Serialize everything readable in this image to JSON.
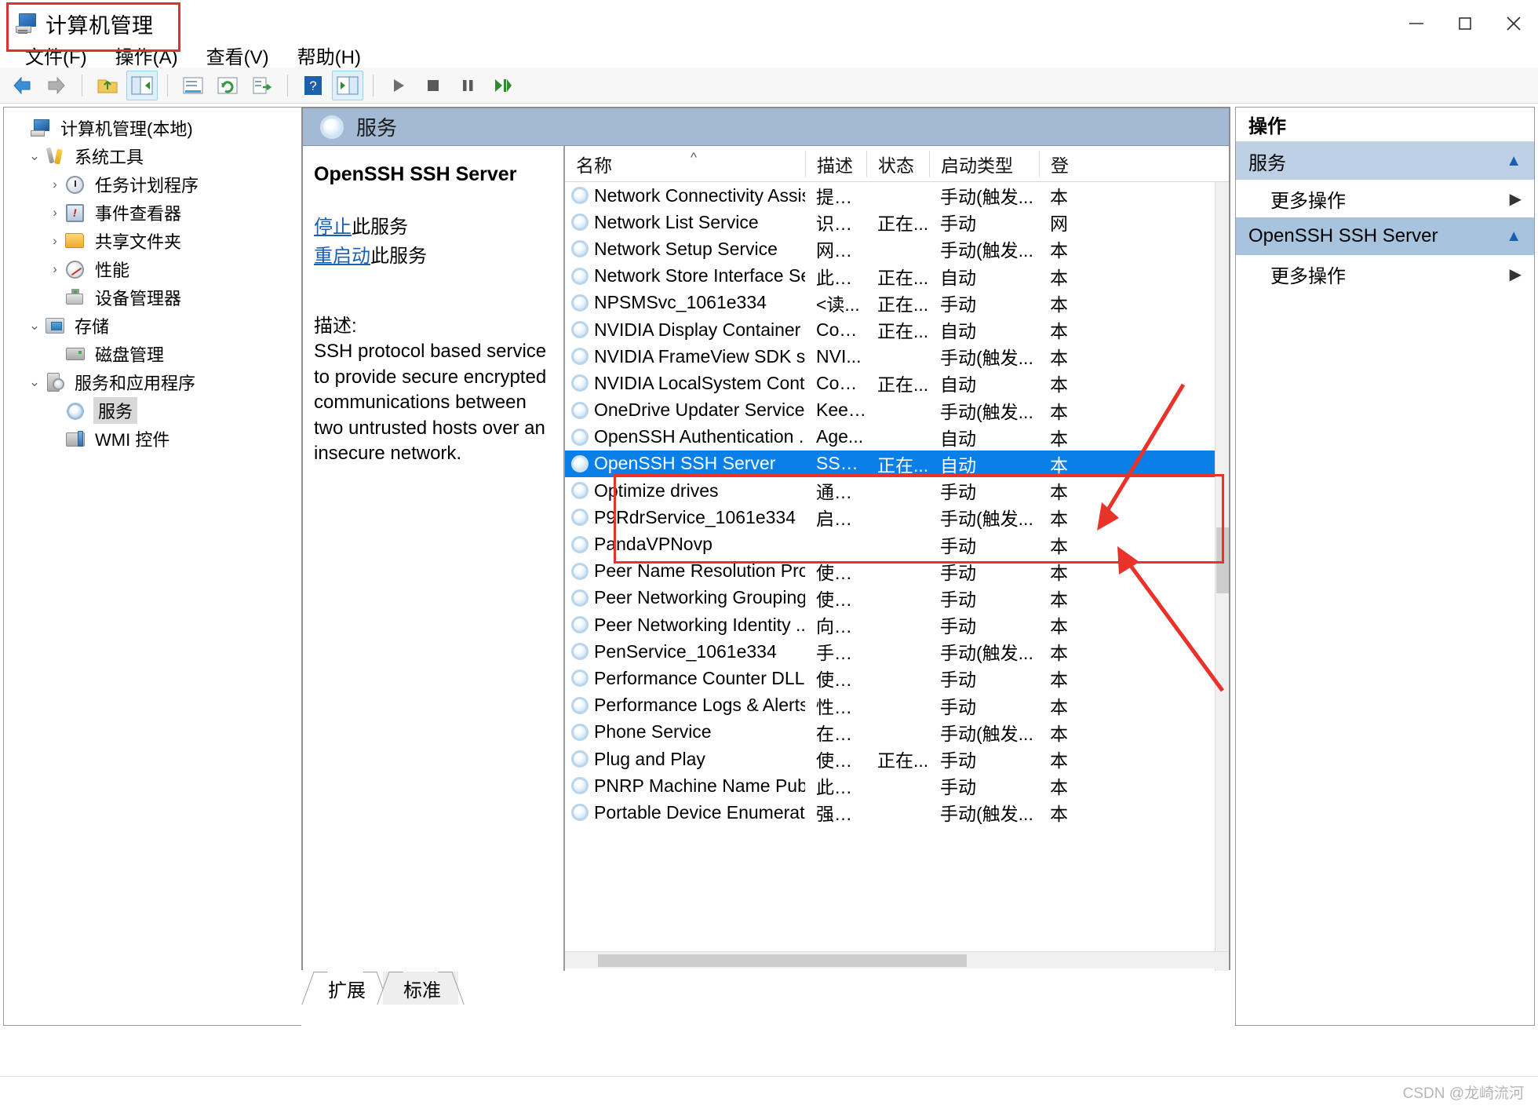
{
  "window": {
    "title": "计算机管理",
    "icon": "computer-management-icon",
    "minimize_label": "—",
    "maximize_label": "▢",
    "close_label": "✕"
  },
  "menu": [
    {
      "label": "文件(F)"
    },
    {
      "label": "操作(A)"
    },
    {
      "label": "查看(V)"
    },
    {
      "label": "帮助(H)"
    }
  ],
  "toolbar": [
    {
      "name": "back-icon"
    },
    {
      "name": "forward-icon"
    },
    {
      "name": "up-folder-icon"
    },
    {
      "name": "show-hide-tree-icon"
    },
    {
      "name": "properties-icon"
    },
    {
      "name": "refresh-icon"
    },
    {
      "name": "export-list-icon"
    },
    {
      "name": "help-icon"
    },
    {
      "name": "show-action-pane-icon"
    },
    {
      "name": "start-service-icon"
    },
    {
      "name": "stop-service-icon"
    },
    {
      "name": "pause-service-icon"
    },
    {
      "name": "restart-service-icon"
    }
  ],
  "tree": [
    {
      "label": "计算机管理(本地)",
      "icon": "computer-icon",
      "depth": 0,
      "chevron": "",
      "selected": false
    },
    {
      "label": "系统工具",
      "icon": "tools-icon",
      "depth": 1,
      "chevron": "v",
      "selected": false
    },
    {
      "label": "任务计划程序",
      "icon": "clock-icon",
      "depth": 2,
      "chevron": ">",
      "selected": false
    },
    {
      "label": "事件查看器",
      "icon": "event-viewer-icon",
      "depth": 2,
      "chevron": ">",
      "selected": false
    },
    {
      "label": "共享文件夹",
      "icon": "shared-folder-icon",
      "depth": 2,
      "chevron": ">",
      "selected": false
    },
    {
      "label": "性能",
      "icon": "performance-icon",
      "depth": 2,
      "chevron": ">",
      "selected": false
    },
    {
      "label": "设备管理器",
      "icon": "device-manager-icon",
      "depth": 2,
      "chevron": "",
      "selected": false
    },
    {
      "label": "存储",
      "icon": "storage-icon",
      "depth": 1,
      "chevron": "v",
      "selected": false
    },
    {
      "label": "磁盘管理",
      "icon": "disk-management-icon",
      "depth": 2,
      "chevron": "",
      "selected": false
    },
    {
      "label": "服务和应用程序",
      "icon": "services-apps-icon",
      "depth": 1,
      "chevron": "v",
      "selected": false
    },
    {
      "label": "服务",
      "icon": "service-gear-icon",
      "depth": 2,
      "chevron": "",
      "selected": true
    },
    {
      "label": "WMI 控件",
      "icon": "wmi-control-icon",
      "depth": 2,
      "chevron": "",
      "selected": false
    }
  ],
  "result_pane": {
    "header_title": "服务",
    "header_icon": "service-gear-icon"
  },
  "detail": {
    "service_name": "OpenSSH SSH Server",
    "stop_link": "停止",
    "stop_suffix": "此服务",
    "restart_link": "重启动",
    "restart_suffix": "此服务",
    "description_label": "描述:",
    "description": "SSH protocol based service to provide secure encrypted communications between two untrusted hosts over an insecure network."
  },
  "list": {
    "columns": [
      "名称",
      "描述",
      "状态",
      "启动类型",
      "登"
    ],
    "sort_indicator": "^",
    "rows": [
      {
        "name": "Network Connectivity Assis...",
        "desc": "提供 ...",
        "status": "",
        "startup": "手动(触发...",
        "logon": "本"
      },
      {
        "name": "Network List Service",
        "desc": "识别...",
        "status": "正在...",
        "startup": "手动",
        "logon": "网"
      },
      {
        "name": "Network Setup Service",
        "desc": "网络...",
        "status": "",
        "startup": "手动(触发...",
        "logon": "本"
      },
      {
        "name": "Network Store Interface Se...",
        "desc": "此服...",
        "status": "正在...",
        "startup": "自动",
        "logon": "本"
      },
      {
        "name": "NPSMSvc_1061e334",
        "desc": "<读...",
        "status": "正在...",
        "startup": "手动",
        "logon": "本"
      },
      {
        "name": "NVIDIA Display Container LS",
        "desc": "Cont...",
        "status": "正在...",
        "startup": "自动",
        "logon": "本"
      },
      {
        "name": "NVIDIA FrameView SDK se...",
        "desc": "NVI...",
        "status": "",
        "startup": "手动(触发...",
        "logon": "本"
      },
      {
        "name": "NVIDIA LocalSystem Conta...",
        "desc": "Cont...",
        "status": "正在...",
        "startup": "自动",
        "logon": "本"
      },
      {
        "name": "OneDrive Updater Service",
        "desc": "Keep...",
        "status": "",
        "startup": "手动(触发...",
        "logon": "本"
      },
      {
        "name": "OpenSSH Authentication ...",
        "desc": "Age...",
        "status": "",
        "startup": "自动",
        "logon": "本"
      },
      {
        "name": "OpenSSH SSH Server",
        "desc": "SSH ...",
        "status": "正在...",
        "startup": "自动",
        "logon": "本",
        "selected": true
      },
      {
        "name": "Optimize drives",
        "desc": "通过...",
        "status": "",
        "startup": "手动",
        "logon": "本"
      },
      {
        "name": "P9RdrService_1061e334",
        "desc": "启用...",
        "status": "",
        "startup": "手动(触发...",
        "logon": "本"
      },
      {
        "name": "PandaVPNovp",
        "desc": "",
        "status": "",
        "startup": "手动",
        "logon": "本"
      },
      {
        "name": "Peer Name Resolution Pro...",
        "desc": "使用...",
        "status": "",
        "startup": "手动",
        "logon": "本"
      },
      {
        "name": "Peer Networking Grouping",
        "desc": "使用...",
        "status": "",
        "startup": "手动",
        "logon": "本"
      },
      {
        "name": "Peer Networking Identity ...",
        "desc": "向对...",
        "status": "",
        "startup": "手动",
        "logon": "本"
      },
      {
        "name": "PenService_1061e334",
        "desc": "手写...",
        "status": "",
        "startup": "手动(触发...",
        "logon": "本"
      },
      {
        "name": "Performance Counter DLL ...",
        "desc": "使远...",
        "status": "",
        "startup": "手动",
        "logon": "本"
      },
      {
        "name": "Performance Logs & Alerts",
        "desc": "性能...",
        "status": "",
        "startup": "手动",
        "logon": "本"
      },
      {
        "name": "Phone Service",
        "desc": "在设...",
        "status": "",
        "startup": "手动(触发...",
        "logon": "本"
      },
      {
        "name": "Plug and Play",
        "desc": "使计...",
        "status": "正在...",
        "startup": "手动",
        "logon": "本"
      },
      {
        "name": "PNRP Machine Name Publ...",
        "desc": "此服...",
        "status": "",
        "startup": "手动",
        "logon": "本"
      },
      {
        "name": "Portable Device Enumerat...",
        "desc": "强制...",
        "status": "",
        "startup": "手动(触发...",
        "logon": "本"
      }
    ]
  },
  "view_tabs": [
    {
      "label": "扩展",
      "active": false
    },
    {
      "label": "标准",
      "active": true
    }
  ],
  "actions": {
    "title": "操作",
    "groups": [
      {
        "header": "服务",
        "collapse_icon": "caret-up-icon",
        "items": [
          {
            "label": "更多操作",
            "arrow": "caret-right-icon"
          }
        ]
      },
      {
        "header": "OpenSSH SSH Server",
        "collapse_icon": "caret-up-icon",
        "selected": true,
        "items": [
          {
            "label": "更多操作",
            "arrow": "caret-right-icon"
          }
        ]
      }
    ]
  },
  "watermark": "CSDN @龙崎流河",
  "annotation": {
    "color": "#e8322a",
    "title_box": true,
    "rows_box": true,
    "arrow_count": 2
  }
}
